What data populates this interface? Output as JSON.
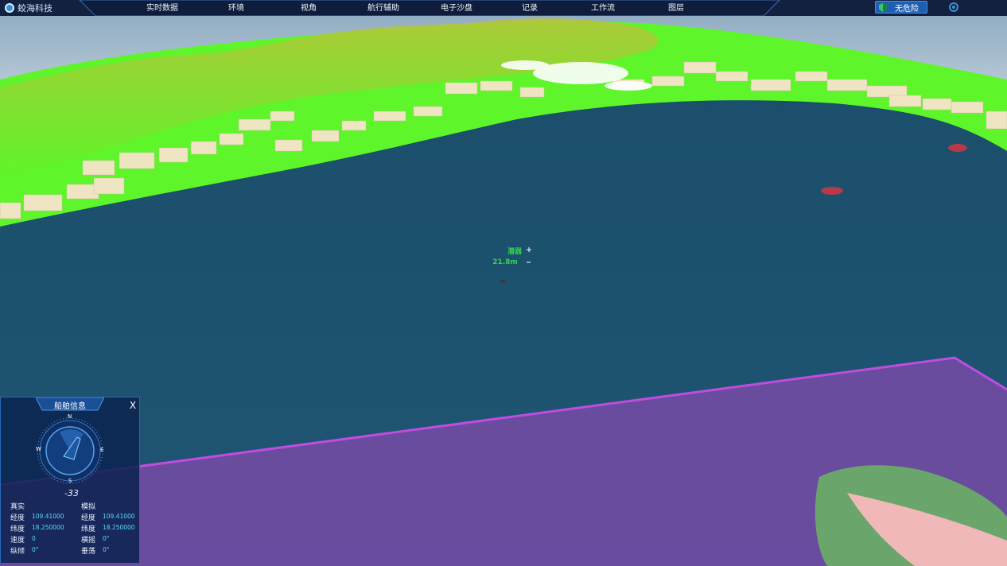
{
  "app": {
    "logo_text": "蛟海科技"
  },
  "nav": {
    "items": [
      "实时数据",
      "环境",
      "视角",
      "航行辅助",
      "电子沙盘",
      "记录",
      "工作流",
      "图层"
    ]
  },
  "status": {
    "danger_label": "无危险",
    "color": "#1f5fb1"
  },
  "scene_labels": {
    "target_name": "潜器",
    "depth": "21.8m"
  },
  "ship_panel": {
    "title": "船舶信息",
    "close": "X",
    "compass": {
      "n": "N",
      "e": "E",
      "s": "S",
      "w": "W",
      "heading": "-33"
    },
    "real": {
      "title": "真实",
      "rows": [
        {
          "label": "经度",
          "value": "109.41000"
        },
        {
          "label": "纬度",
          "value": "18.250000"
        },
        {
          "label": "速度",
          "value": "0"
        },
        {
          "label": "纵倾",
          "value": "0°"
        }
      ]
    },
    "sim": {
      "title": "模拟",
      "rows": [
        {
          "label": "经度",
          "value": "109.41000"
        },
        {
          "label": "纬度",
          "value": "18.250000"
        },
        {
          "label": "横摇",
          "value": "0°"
        },
        {
          "label": "垂荡",
          "value": "0°"
        }
      ]
    }
  },
  "colors": {
    "sea": "#1e536f",
    "land": "#5ef52a",
    "zone": "#7a4aa8",
    "ui_accent": "#2a68b8"
  }
}
